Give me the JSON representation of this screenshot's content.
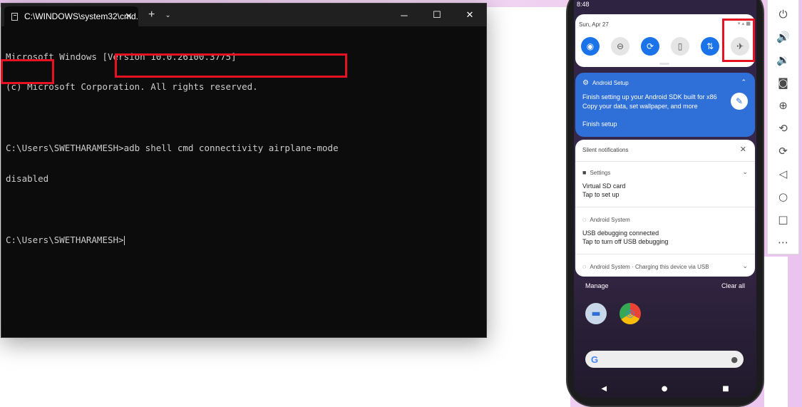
{
  "cmd_window": {
    "tab_title": "C:\\WINDOWS\\system32\\cmd.",
    "tab_close": "✕",
    "new_tab": "+",
    "dropdown": "⌄",
    "minimize": "─",
    "maximize": "☐",
    "close": "✕",
    "lines": [
      "Microsoft Windows [Version 10.0.26100.3775]",
      "(c) Microsoft Corporation. All rights reserved.",
      "",
      "C:\\Users\\SWETHARAMESH>adb shell cmd connectivity airplane-mode",
      "disabled",
      ""
    ],
    "prompt": "C:\\Users\\SWETHARAMESH>"
  },
  "phone": {
    "status_time": "8:48",
    "quick_settings": {
      "date": "Sun, Apr 27",
      "status_icons": "▾ ▴ ■",
      "tiles": [
        {
          "name": "wifi",
          "glyph": "◉",
          "state": "on"
        },
        {
          "name": "do-not-disturb",
          "glyph": "⊖",
          "state": "off"
        },
        {
          "name": "auto-rotate",
          "glyph": "⟳",
          "state": "on"
        },
        {
          "name": "battery-saver",
          "glyph": "▯",
          "state": "off"
        },
        {
          "name": "mobile-data",
          "glyph": "⇅",
          "state": "on"
        },
        {
          "name": "airplane-mode",
          "glyph": "✈",
          "state": "off"
        }
      ]
    },
    "setup_notification": {
      "app": "Android Setup",
      "gear": "⚙",
      "chevron": "⌃",
      "title": "Finish setting up your Android SDK built for x86",
      "subtitle": "Copy your data, set wallpaper, and more",
      "action": "Finish setup",
      "wand": "✎"
    },
    "silent": {
      "header": "Silent notifications",
      "close": "✕",
      "items": [
        {
          "app": "Settings",
          "icon": "■",
          "chevron": "⌄",
          "line1": "Virtual SD card",
          "line2": "Tap to set up"
        },
        {
          "app": "Android System",
          "icon": "◌",
          "line1": "USB debugging connected",
          "line2": "Tap to turn off USB debugging"
        },
        {
          "app": "Android System · Charging this device via USB",
          "icon": "◌",
          "chevron": "⌄"
        }
      ]
    },
    "manage": "Manage",
    "clear_all": "Clear all",
    "dock": {
      "messages_glyph": "▬",
      "chrome_glyph": "◎"
    },
    "search": {
      "logo": "G",
      "mic": "●"
    },
    "nav": {
      "back": "◀",
      "home": "●",
      "recents": "■"
    }
  },
  "emulator_toolbar": [
    {
      "name": "power",
      "glyph": "⏻"
    },
    {
      "name": "volume-up",
      "glyph": "🔊"
    },
    {
      "name": "volume-down",
      "glyph": "🔉"
    },
    {
      "name": "camera",
      "glyph": "◙"
    },
    {
      "name": "zoom",
      "glyph": "⊕"
    },
    {
      "name": "rotate-left",
      "glyph": "⟲"
    },
    {
      "name": "rotate-right",
      "glyph": "⟳"
    },
    {
      "name": "back",
      "glyph": "◁"
    },
    {
      "name": "home",
      "glyph": "○"
    },
    {
      "name": "overview",
      "glyph": "□"
    },
    {
      "name": "more",
      "glyph": "⋯"
    }
  ],
  "colors": {
    "highlight": "#e81123",
    "accent": "#1a73e8"
  }
}
